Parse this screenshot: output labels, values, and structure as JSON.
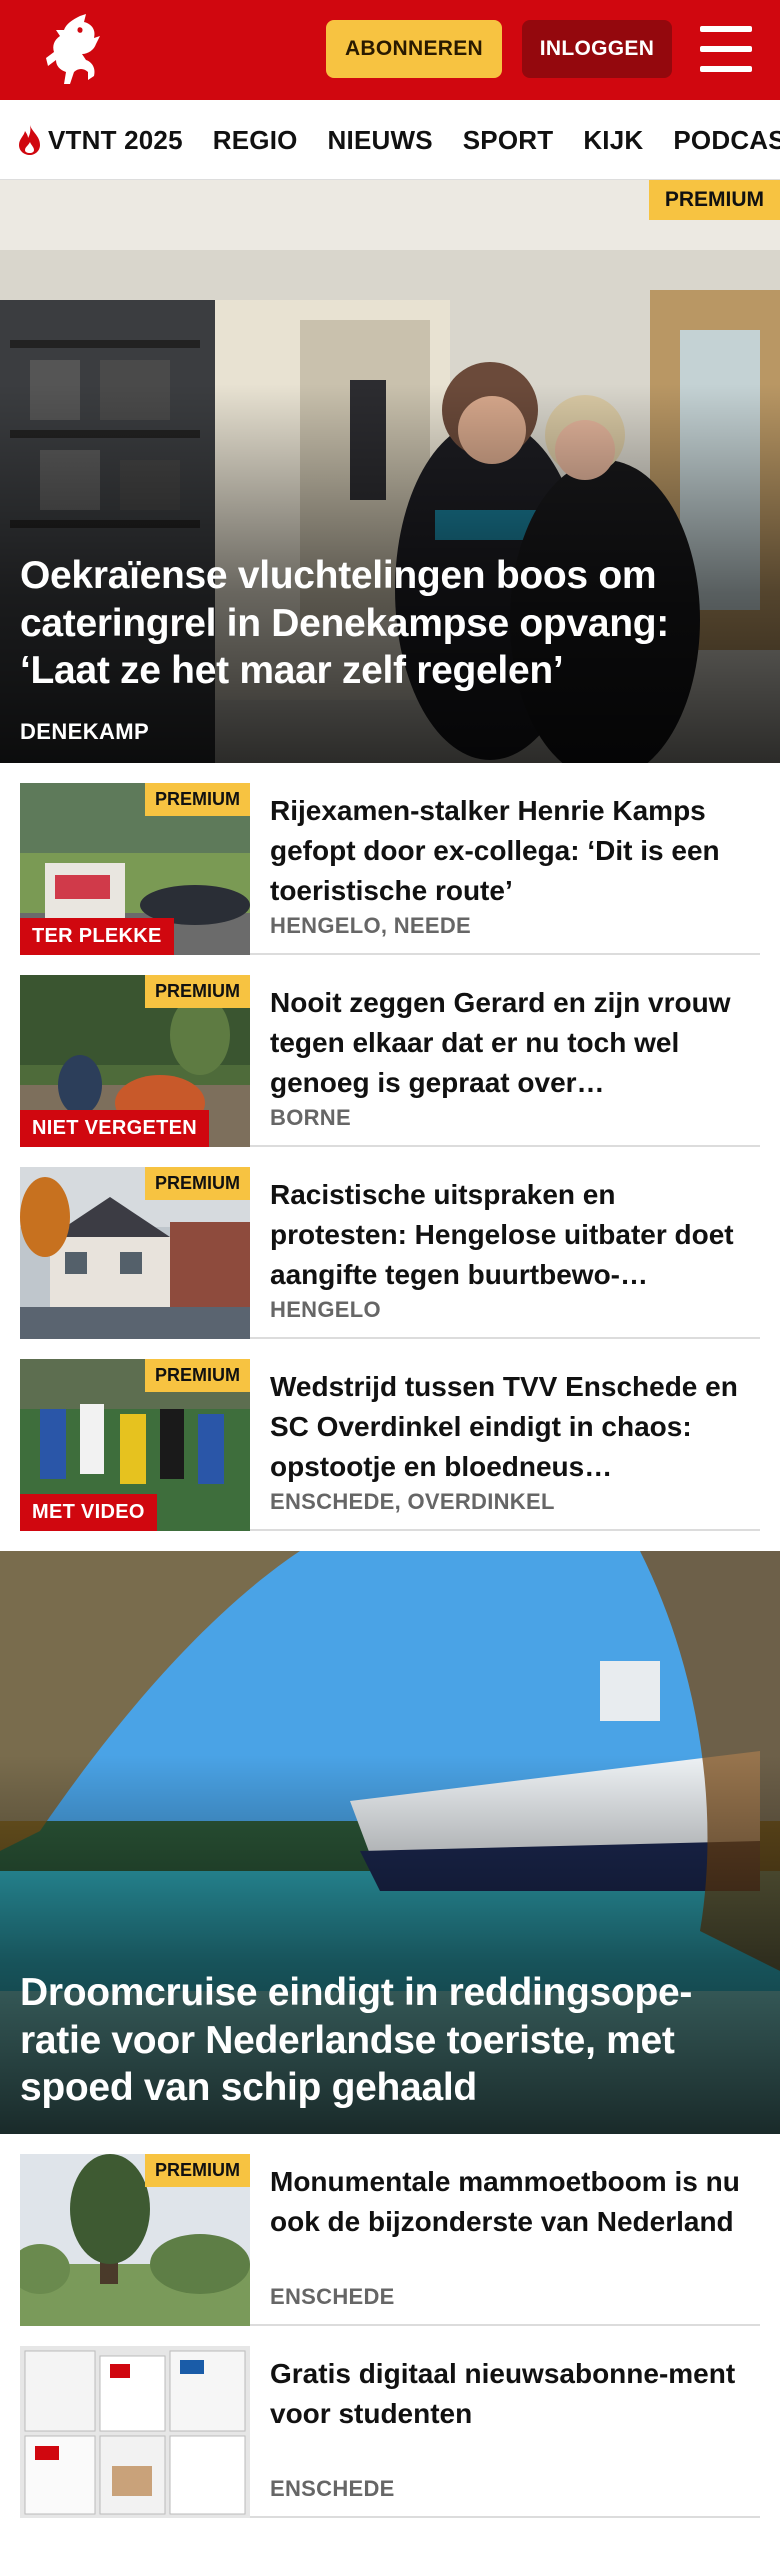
{
  "header": {
    "subscribe_label": "ABONNEREN",
    "login_label": "INLOGGEN",
    "brand_color": "#d0070f",
    "accent_color": "#f7c341"
  },
  "nav": {
    "items": [
      "VTNT 2025",
      "REGIO",
      "NIEUWS",
      "SPORT",
      "KIJK",
      "PODCAST"
    ]
  },
  "hero1": {
    "badge": "PREMIUM",
    "title": "Oekraïense vluchtelingen boos om cateringrel in Denekampse opvang: ‘Laat ze het maar zelf regelen’",
    "location": "DENEKAMP"
  },
  "articles": [
    {
      "badge": "PREMIUM",
      "label": "TER PLEKKE",
      "title": "Rijexamen-stalker Henrie Kamps gefopt door ex-collega: ‘Dit is een toeristische route’",
      "location": "HENGELO, NEEDE"
    },
    {
      "badge": "PREMIUM",
      "label": "NIET VERGETEN",
      "title": "Nooit zeggen Gerard en zijn vrouw tegen elkaar dat er nu toch wel genoeg is gepraat over…",
      "location": "BORNE"
    },
    {
      "badge": "PREMIUM",
      "label": "",
      "title": "Racistische uitspraken en protesten: Hengelose uitbater doet aangifte tegen buurtbewo-…",
      "location": "HENGELO"
    },
    {
      "badge": "PREMIUM",
      "label": "MET VIDEO",
      "title": "Wedstrijd tussen TVV Enschede en SC Overdinkel eindigt in chaos: opstootje en bloedneus…",
      "location": "ENSCHEDE, OVERDINKEL"
    }
  ],
  "hero2": {
    "title": "Droomcruise eindigt in reddingsope-ratie voor Nederlandse toeriste, met spoed van schip gehaald"
  },
  "articles2": [
    {
      "badge": "PREMIUM",
      "title": "Monumentale mammoetboom is nu ook de bijzonderste van Nederland",
      "location": "ENSCHEDE"
    },
    {
      "title": "Gratis digitaal nieuwsabonne-ment voor studenten",
      "location": "ENSCHEDE"
    }
  ]
}
